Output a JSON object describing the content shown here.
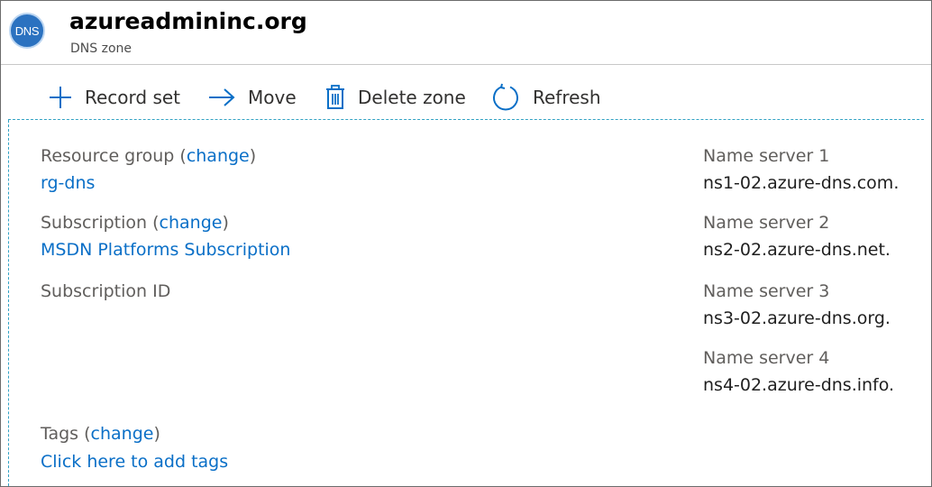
{
  "header": {
    "icon_text": "DNS",
    "title": "azureadmininc.org",
    "subtitle": "DNS zone"
  },
  "toolbar": {
    "record_set": "Record set",
    "move": "Move",
    "delete_zone": "Delete zone",
    "refresh": "Refresh"
  },
  "essentials": {
    "resource_group_label": "Resource group (",
    "resource_group_change": "change",
    "resource_group_close": ")",
    "resource_group_value": "rg-dns",
    "subscription_label": "Subscription (",
    "subscription_change": "change",
    "subscription_close": ")",
    "subscription_value": "MSDN Platforms Subscription",
    "subscription_id_label": "Subscription ID",
    "tags_label": "Tags (",
    "tags_change": "change",
    "tags_close": ")",
    "tags_add": "Click here to add tags"
  },
  "name_servers": [
    {
      "label": "Name server 1",
      "value": "ns1-02.azure-dns.com."
    },
    {
      "label": "Name server 2",
      "value": "ns2-02.azure-dns.net."
    },
    {
      "label": "Name server 3",
      "value": "ns3-02.azure-dns.org."
    },
    {
      "label": "Name server 4",
      "value": "ns4-02.azure-dns.info."
    }
  ],
  "colors": {
    "accent": "#0a6fc7",
    "icon_bg": "#2b72c0",
    "dashed_border": "#32a2c4"
  },
  "icons": {
    "record_set": "plus-icon",
    "move": "arrow-right-icon",
    "delete_zone": "trash-icon",
    "refresh": "refresh-icon",
    "zone": "dns-icon"
  }
}
